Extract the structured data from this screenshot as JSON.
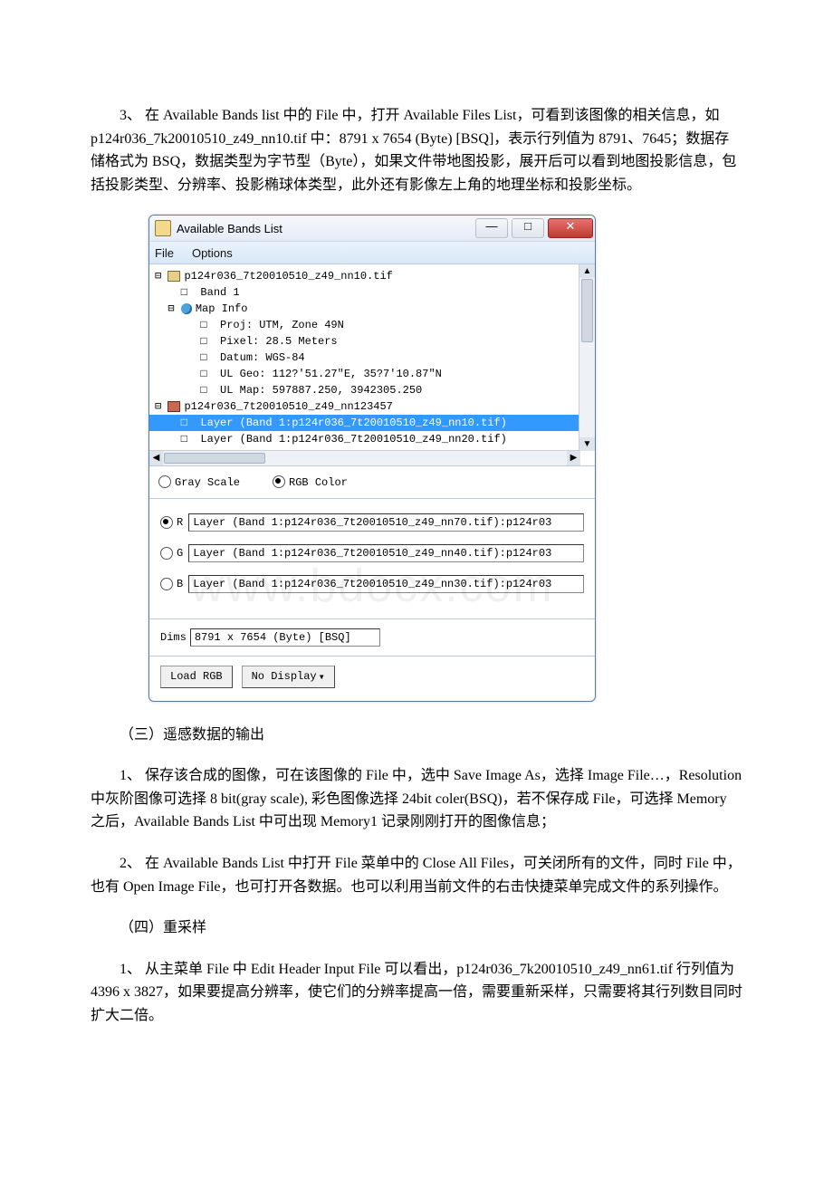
{
  "para1": "3、 在 Available Bands list 中的 File 中，打开 Available Files List，可看到该图像的相关信息，如 p124r036_7k20010510_z49_nn10.tif 中：8791 x 7654 (Byte) [BSQ]，表示行列值为 8791、7645；数据存储格式为 BSQ，数据类型为字节型（Byte），如果文件带地图投影，展开后可以看到地图投影信息，包括投影类型、分辨率、投影椭球体类型，此外还有影像左上角的地理坐标和投影坐标。",
  "window": {
    "title": "Available Bands List",
    "menu_file": "File",
    "menu_options": "Options",
    "tree": {
      "file1": "p124r036_7t20010510_z49_nn10.tif",
      "band1": "Band 1",
      "mapinfo": "Map Info",
      "proj": "Proj: UTM, Zone 49N",
      "pixel": "Pixel: 28.5 Meters",
      "datum": "Datum: WGS-84",
      "ulgeo": "UL Geo: 112?'51.27\"E, 35?7'10.87\"N",
      "ulmap": "UL Map: 597887.250, 3942305.250",
      "file2": "p124r036_7t20010510_z49_nn123457",
      "layer1": "Layer (Band 1:p124r036_7t20010510_z49_nn10.tif)",
      "layer2": "Layer (Band 1:p124r036_7t20010510_z49_nn20.tif)"
    },
    "mode_gray": "Gray Scale",
    "mode_rgb": "RGB Color",
    "rgb": {
      "r_label": "R",
      "g_label": "G",
      "b_label": "B",
      "r_value": "Layer (Band 1:p124r036_7t20010510_z49_nn70.tif):p124r03",
      "g_value": "Layer (Band 1:p124r036_7t20010510_z49_nn40.tif):p124r03",
      "b_value": "Layer (Band 1:p124r036_7t20010510_z49_nn30.tif):p124r03"
    },
    "dims_label": "Dims",
    "dims_value": "8791 x 7654 (Byte) [BSQ]",
    "load_btn": "Load RGB",
    "display_btn": "No Display"
  },
  "watermark": "www.bdocx.com",
  "para2": "（三）遥感数据的输出",
  "para3": "1、 保存该合成的图像，可在该图像的 File 中，选中 Save Image As，选择 Image File…，Resolution 中灰阶图像可选择 8 bit(gray scale), 彩色图像选择 24bit coler(BSQ)，若不保存成 File，可选择 Memory 之后，Available Bands List 中可出现 Memory1 记录刚刚打开的图像信息；",
  "para4": "2、 在 Available Bands List 中打开 File 菜单中的 Close All Files，可关闭所有的文件，同时 File 中，也有 Open Image File，也可打开各数据。也可以利用当前文件的右击快捷菜单完成文件的系列操作。",
  "para5": "（四）重采样",
  "para6": "1、 从主菜单 File 中 Edit Header Input File 可以看出，p124r036_7k20010510_z49_nn61.tif 行列值为 4396 x 3827，如果要提高分辨率，使它们的分辨率提高一倍，需要重新采样，只需要将其行列数目同时扩大二倍。"
}
